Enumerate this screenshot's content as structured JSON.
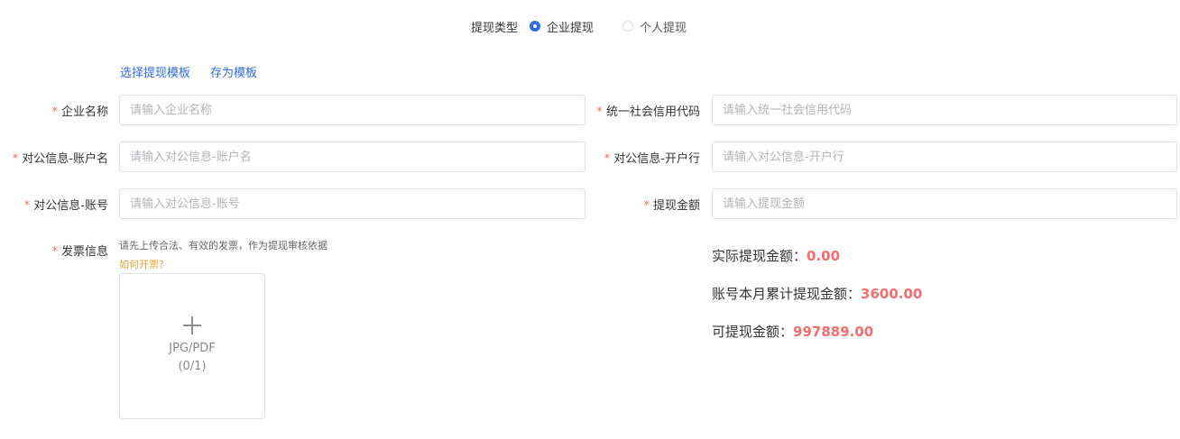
{
  "withdraw_type": {
    "label": "提现类型",
    "options": [
      {
        "label": "企业提现",
        "checked": true
      },
      {
        "label": "个人提现",
        "checked": false
      }
    ]
  },
  "template_links": {
    "select_label": "选择提现模板",
    "save_label": "存为模板"
  },
  "required_mark": "*",
  "fields": {
    "company_name": {
      "label": "企业名称",
      "placeholder": "请输入企业名称"
    },
    "credit_code": {
      "label": "统一社会信用代码",
      "placeholder": "请输入统一社会信用代码"
    },
    "account_name": {
      "label": "对公信息-账户名",
      "placeholder": "请输入对公信息-账户名"
    },
    "bank_name": {
      "label": "对公信息-开户行",
      "placeholder": "请输入对公信息-开户行"
    },
    "account_number": {
      "label": "对公信息-账号",
      "placeholder": "请输入对公信息-账号"
    },
    "withdraw_amount": {
      "label": "提现金额",
      "placeholder": "请输入提现金额"
    }
  },
  "invoice": {
    "label": "发票信息",
    "hint": "请先上传合法、有效的发票，作为提现审核依据",
    "how_link": "如何开票?",
    "upload_format": "JPG/PDF",
    "upload_count": "(0/1)"
  },
  "amounts": {
    "actual": {
      "label": "实际提现金额：",
      "value": "0.00"
    },
    "monthly": {
      "label": "账号本月累计提现金额：",
      "value": "3600.00"
    },
    "available": {
      "label": "可提现金额：",
      "value": "997889.00"
    }
  },
  "colors": {
    "primary": "#2f6be3",
    "required": "#f56c6c",
    "amount": "#f56c6c",
    "link_warn": "#e6a23c"
  }
}
